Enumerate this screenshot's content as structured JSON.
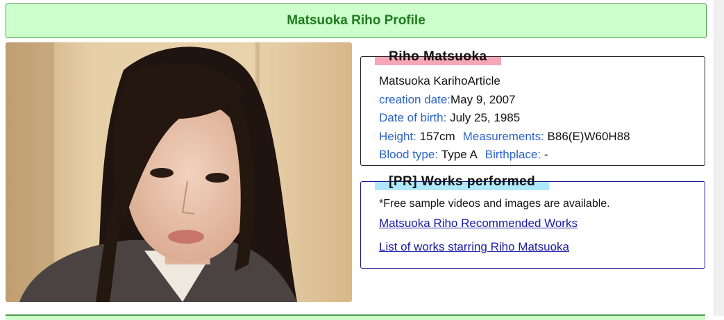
{
  "header": {
    "title": "Matsuoka Riho Profile"
  },
  "profile": {
    "name": "Riho Matsuoka",
    "article": "Matsuoka KarihoArticle",
    "creation_label": "creation date:",
    "creation_value": "May 9, 2007",
    "dob_label": "Date of birth:",
    "dob_value": "July 25, 1985",
    "height_label": "Height:",
    "height_value": "157cm",
    "measurements_label": "Measurements:",
    "measurements_value": "B86(E)W60H88",
    "blood_label": "Blood type:",
    "blood_value": "Type A",
    "birthplace_label": "Birthplace:",
    "birthplace_value": "-"
  },
  "works": {
    "title": "[PR] Works performed",
    "note": "*Free sample videos and images are available.",
    "link1": "Matsuoka Riho Recommended Works",
    "link2": "List of works starring Riho Matsuoka"
  },
  "colors": {
    "header_bg": "#ccffcc",
    "header_text": "#1e7a1e",
    "label_blue": "#2a63c8",
    "link_blue": "#1a1aaa",
    "pink_highlight": "#f7a6b8",
    "blue_highlight": "#aee8fb"
  }
}
